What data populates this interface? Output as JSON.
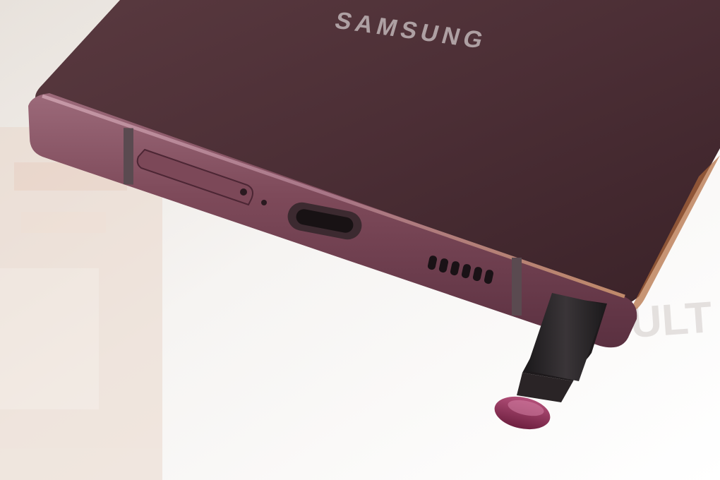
{
  "photo": {
    "brand_logo": "SAMSUNG",
    "background_lettering": "ULT"
  },
  "colors": {
    "background": "#f4f2f0",
    "phone_back": "#4a2d33",
    "frame": "#7a4656",
    "frame_highlight": "#a06a7d",
    "spen_body": "#2a2628",
    "spen_tip": "#8a2f55"
  }
}
